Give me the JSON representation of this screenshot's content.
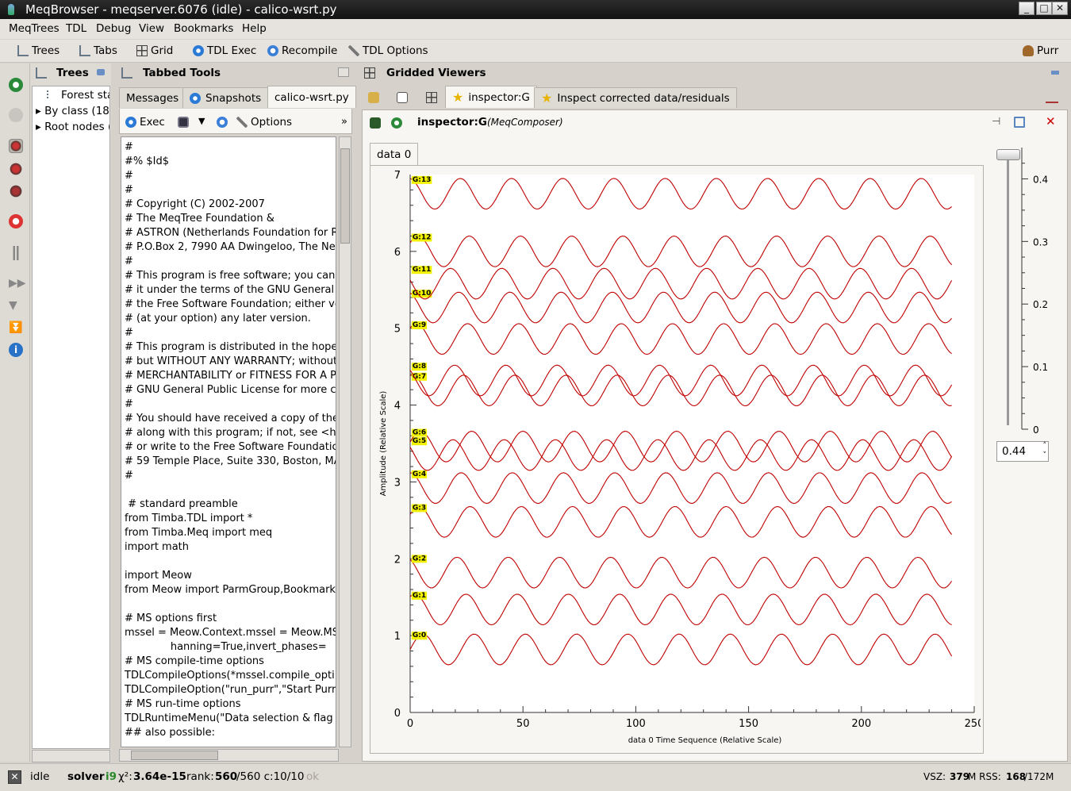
{
  "window": {
    "title": "MeqBrowser - meqserver.6076 (idle) - calico-wsrt.py",
    "buttons": [
      "_",
      "□",
      "X"
    ]
  },
  "menubar": [
    "MeqTrees",
    "TDL",
    "Debug",
    "View",
    "Bookmarks",
    "Help"
  ],
  "toolbar": {
    "trees": "Trees",
    "tabs": "Tabs",
    "grid": "Grid",
    "tdl_exec": "TDL Exec",
    "recompile": "Recompile",
    "tdl_options": "TDL Options",
    "purr": "Purr"
  },
  "trees_panel": {
    "title": "Trees",
    "items": [
      "Forest sta",
      "By class (18)",
      "Root nodes ("
    ]
  },
  "tabbed_tools": {
    "title": "Tabbed Tools",
    "tabs": [
      "Messages",
      "Snapshots",
      "calico-wsrt.py"
    ],
    "exec_label": "Exec",
    "options_label": "Options",
    "more": "»",
    "code_lines": [
      "#",
      "#% $Id$",
      "#",
      "#",
      "# Copyright (C) 2002-2007",
      "# The MeqTree Foundation &",
      "# ASTRON (Netherlands Foundation for R",
      "# P.O.Box 2, 7990 AA Dwingeloo, The Net",
      "#",
      "# This program is free software; you can",
      "# it under the terms of the GNU General",
      "# the Free Software Foundation; either ve",
      "# (at your option) any later version.",
      "#",
      "# This program is distributed in the hope",
      "# but WITHOUT ANY WARRANTY; without",
      "# MERCHANTABILITY or FITNESS FOR A PA",
      "# GNU General Public License for more c",
      "#",
      "# You should have received a copy of the",
      "# along with this program; if not, see <h",
      "# or write to the Free Software Foundatic",
      "# 59 Temple Place, Suite 330, Boston, MA",
      "#",
      "",
      " # standard preamble",
      "from Timba.TDL import *",
      "from Timba.Meq import meq",
      "import math",
      "",
      "import Meow",
      "from Meow import ParmGroup,Bookmark",
      "",
      "# MS options first",
      "mssel = Meow.Context.mssel = Meow.MS",
      "              hanning=True,invert_phases=",
      "# MS compile-time options",
      "TDLCompileOptions(*mssel.compile_opti",
      "TDLCompileOption(\"run_purr\",\"Start Purr",
      "# MS run-time options",
      "TDLRuntimeMenu(\"Data selection & flag",
      "## also possible:"
    ]
  },
  "gridded": {
    "title": "Gridded Viewers",
    "tabs": [
      "inspector:G",
      "Inspect corrected data/residuals"
    ],
    "viewer_name": "inspector:G",
    "viewer_sub": "(MeqComposer)",
    "data_tab": "data 0"
  },
  "chart_data": {
    "type": "line",
    "xlabel": "data 0 Time Sequence (Relative Scale)",
    "ylabel": "Amplitude (Relative Scale)",
    "xlim": [
      0,
      250
    ],
    "ylim": [
      0,
      7
    ],
    "xticks": [
      "0",
      "50",
      "100",
      "150",
      "200",
      "250"
    ],
    "yticks": [
      "0",
      "1",
      "2",
      "3",
      "4",
      "5",
      "6",
      "7"
    ],
    "line_color": "#c00000",
    "label_color": "#f2f200",
    "series": [
      {
        "name": "G:0",
        "offset": 0.82,
        "amp": 0.2,
        "phase": 0.0
      },
      {
        "name": "G:1",
        "offset": 1.34,
        "amp": 0.2,
        "phase": 1.0
      },
      {
        "name": "G:2",
        "offset": 1.82,
        "amp": 0.2,
        "phase": 2.1
      },
      {
        "name": "G:3",
        "offset": 2.48,
        "amp": 0.2,
        "phase": 0.5
      },
      {
        "name": "G:4",
        "offset": 2.92,
        "amp": 0.2,
        "phase": 1.6
      },
      {
        "name": "G:5",
        "offset": 3.35,
        "amp": 0.2,
        "phase": 2.6
      },
      {
        "name": "G:6",
        "offset": 3.46,
        "amp": 0.2,
        "phase": 0.3
      },
      {
        "name": "G:7",
        "offset": 4.19,
        "amp": 0.2,
        "phase": 1.3
      },
      {
        "name": "G:8",
        "offset": 4.32,
        "amp": 0.2,
        "phase": 2.4
      },
      {
        "name": "G:9",
        "offset": 4.86,
        "amp": 0.2,
        "phase": 0.8
      },
      {
        "name": "G:10",
        "offset": 5.27,
        "amp": 0.2,
        "phase": 1.9
      },
      {
        "name": "G:11",
        "offset": 5.58,
        "amp": 0.2,
        "phase": 2.9
      },
      {
        "name": "G:12",
        "offset": 6.0,
        "amp": 0.2,
        "phase": 0.6
      },
      {
        "name": "G:13",
        "offset": 6.75,
        "amp": 0.2,
        "phase": 1.7
      }
    ]
  },
  "slider": {
    "ticks": [
      "0.4",
      "0.3",
      "0.2",
      "0.1",
      "0"
    ],
    "value": "0.44",
    "level": 0.44
  },
  "status": {
    "idle": "idle",
    "solver_label": "solver",
    "solver_iter": "i9",
    "chi_label": "χ²:",
    "chi_value": "3.64e-15",
    "rank_label": "rank:",
    "rank_value": "560",
    "rank_total": "/560 c:10/10",
    "ok": "ok",
    "vsz_label": "VSZ:",
    "vsz_value": "379",
    "rss_label": "M RSS:",
    "rss_value": "168",
    "rss_total": "/172M"
  }
}
